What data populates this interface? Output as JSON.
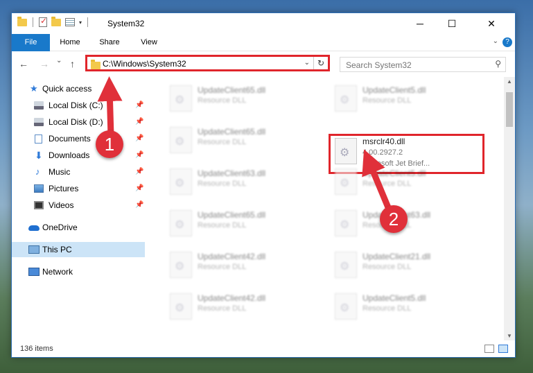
{
  "window": {
    "title": "System32",
    "controls": {
      "minimize": "─",
      "maximize": "☐",
      "close": "✕"
    }
  },
  "ribbon": {
    "tabs": [
      {
        "label": "File"
      },
      {
        "label": "Home"
      },
      {
        "label": "Share"
      },
      {
        "label": "View"
      }
    ]
  },
  "nav": {
    "back": "←",
    "forward": "→",
    "recent": "⌄",
    "up": "↑",
    "address": "C:\\Windows\\System32",
    "search_placeholder": "Search System32"
  },
  "sidebar": {
    "items": [
      {
        "label": "Quick access",
        "icon": "star-icon",
        "pinned": false
      },
      {
        "label": "Local Disk (C:)",
        "icon": "disk-icon",
        "pinned": true
      },
      {
        "label": "Local Disk (D:)",
        "icon": "disk-icon",
        "pinned": true
      },
      {
        "label": "Documents",
        "icon": "documents-icon",
        "pinned": true
      },
      {
        "label": "Downloads",
        "icon": "download-icon",
        "pinned": true
      },
      {
        "label": "Music",
        "icon": "music-icon",
        "pinned": true
      },
      {
        "label": "Pictures",
        "icon": "pictures-icon",
        "pinned": true
      },
      {
        "label": "Videos",
        "icon": "videos-icon",
        "pinned": true
      },
      {
        "label": "OneDrive",
        "icon": "cloud-icon",
        "pinned": false
      },
      {
        "label": "This PC",
        "icon": "computer-icon",
        "pinned": false,
        "selected": true
      },
      {
        "label": "Network",
        "icon": "network-icon",
        "pinned": false
      }
    ]
  },
  "files": [
    {
      "name": "UpdateClient65.dll",
      "type": "Resource DLL"
    },
    {
      "name": "UpdateClient5.dll",
      "type": "Resource DLL"
    },
    {
      "name": "UpdateClient65.dll",
      "type": "Resource DLL"
    },
    {
      "name": "msrclr40.dll",
      "version": "4.00.2927.2",
      "description": "Microsoft Jet Brief..."
    },
    {
      "name": "UpdateClient63.dll",
      "type": "Resource DLL"
    },
    {
      "name": "UpdateClient5.dll",
      "type": "Resource DLL"
    },
    {
      "name": "UpdateClient65.dll",
      "type": "Resource DLL"
    },
    {
      "name": "UpdateClient63.dll",
      "type": "Resource DLL"
    },
    {
      "name": "UpdateClient42.dll",
      "type": "Resource DLL"
    },
    {
      "name": "UpdateClient21.dll",
      "type": "Resource DLL"
    },
    {
      "name": "UpdateClient42.dll",
      "type": "Resource DLL"
    },
    {
      "name": "UpdateClient5.dll",
      "type": "Resource DLL"
    }
  ],
  "status": {
    "item_count": "136 items"
  },
  "annotations": {
    "step1": "1",
    "step2": "2",
    "color": "#e0252b"
  }
}
